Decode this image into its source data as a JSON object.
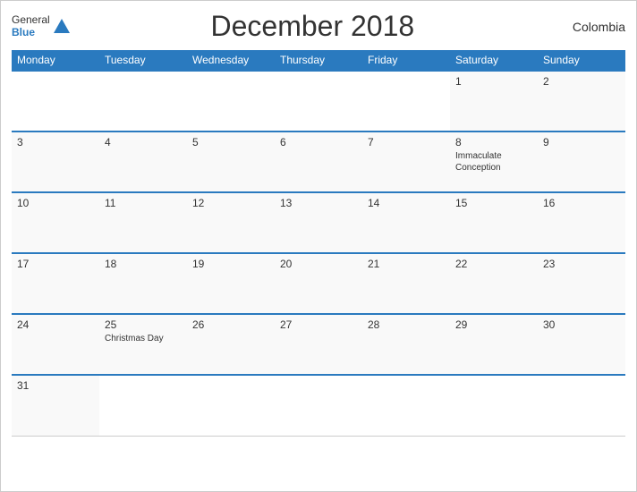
{
  "header": {
    "logo_general": "General",
    "logo_blue": "Blue",
    "title": "December 2018",
    "country": "Colombia"
  },
  "weekdays": [
    "Monday",
    "Tuesday",
    "Wednesday",
    "Thursday",
    "Friday",
    "Saturday",
    "Sunday"
  ],
  "weeks": [
    [
      {
        "day": "",
        "holiday": ""
      },
      {
        "day": "",
        "holiday": ""
      },
      {
        "day": "",
        "holiday": ""
      },
      {
        "day": "",
        "holiday": ""
      },
      {
        "day": "",
        "holiday": ""
      },
      {
        "day": "1",
        "holiday": ""
      },
      {
        "day": "2",
        "holiday": ""
      }
    ],
    [
      {
        "day": "3",
        "holiday": ""
      },
      {
        "day": "4",
        "holiday": ""
      },
      {
        "day": "5",
        "holiday": ""
      },
      {
        "day": "6",
        "holiday": ""
      },
      {
        "day": "7",
        "holiday": ""
      },
      {
        "day": "8",
        "holiday": "Immaculate Conception"
      },
      {
        "day": "9",
        "holiday": ""
      }
    ],
    [
      {
        "day": "10",
        "holiday": ""
      },
      {
        "day": "11",
        "holiday": ""
      },
      {
        "day": "12",
        "holiday": ""
      },
      {
        "day": "13",
        "holiday": ""
      },
      {
        "day": "14",
        "holiday": ""
      },
      {
        "day": "15",
        "holiday": ""
      },
      {
        "day": "16",
        "holiday": ""
      }
    ],
    [
      {
        "day": "17",
        "holiday": ""
      },
      {
        "day": "18",
        "holiday": ""
      },
      {
        "day": "19",
        "holiday": ""
      },
      {
        "day": "20",
        "holiday": ""
      },
      {
        "day": "21",
        "holiday": ""
      },
      {
        "day": "22",
        "holiday": ""
      },
      {
        "day": "23",
        "holiday": ""
      }
    ],
    [
      {
        "day": "24",
        "holiday": ""
      },
      {
        "day": "25",
        "holiday": "Christmas Day"
      },
      {
        "day": "26",
        "holiday": ""
      },
      {
        "day": "27",
        "holiday": ""
      },
      {
        "day": "28",
        "holiday": ""
      },
      {
        "day": "29",
        "holiday": ""
      },
      {
        "day": "30",
        "holiday": ""
      }
    ],
    [
      {
        "day": "31",
        "holiday": ""
      },
      {
        "day": "",
        "holiday": ""
      },
      {
        "day": "",
        "holiday": ""
      },
      {
        "day": "",
        "holiday": ""
      },
      {
        "day": "",
        "holiday": ""
      },
      {
        "day": "",
        "holiday": ""
      },
      {
        "day": "",
        "holiday": ""
      }
    ]
  ]
}
